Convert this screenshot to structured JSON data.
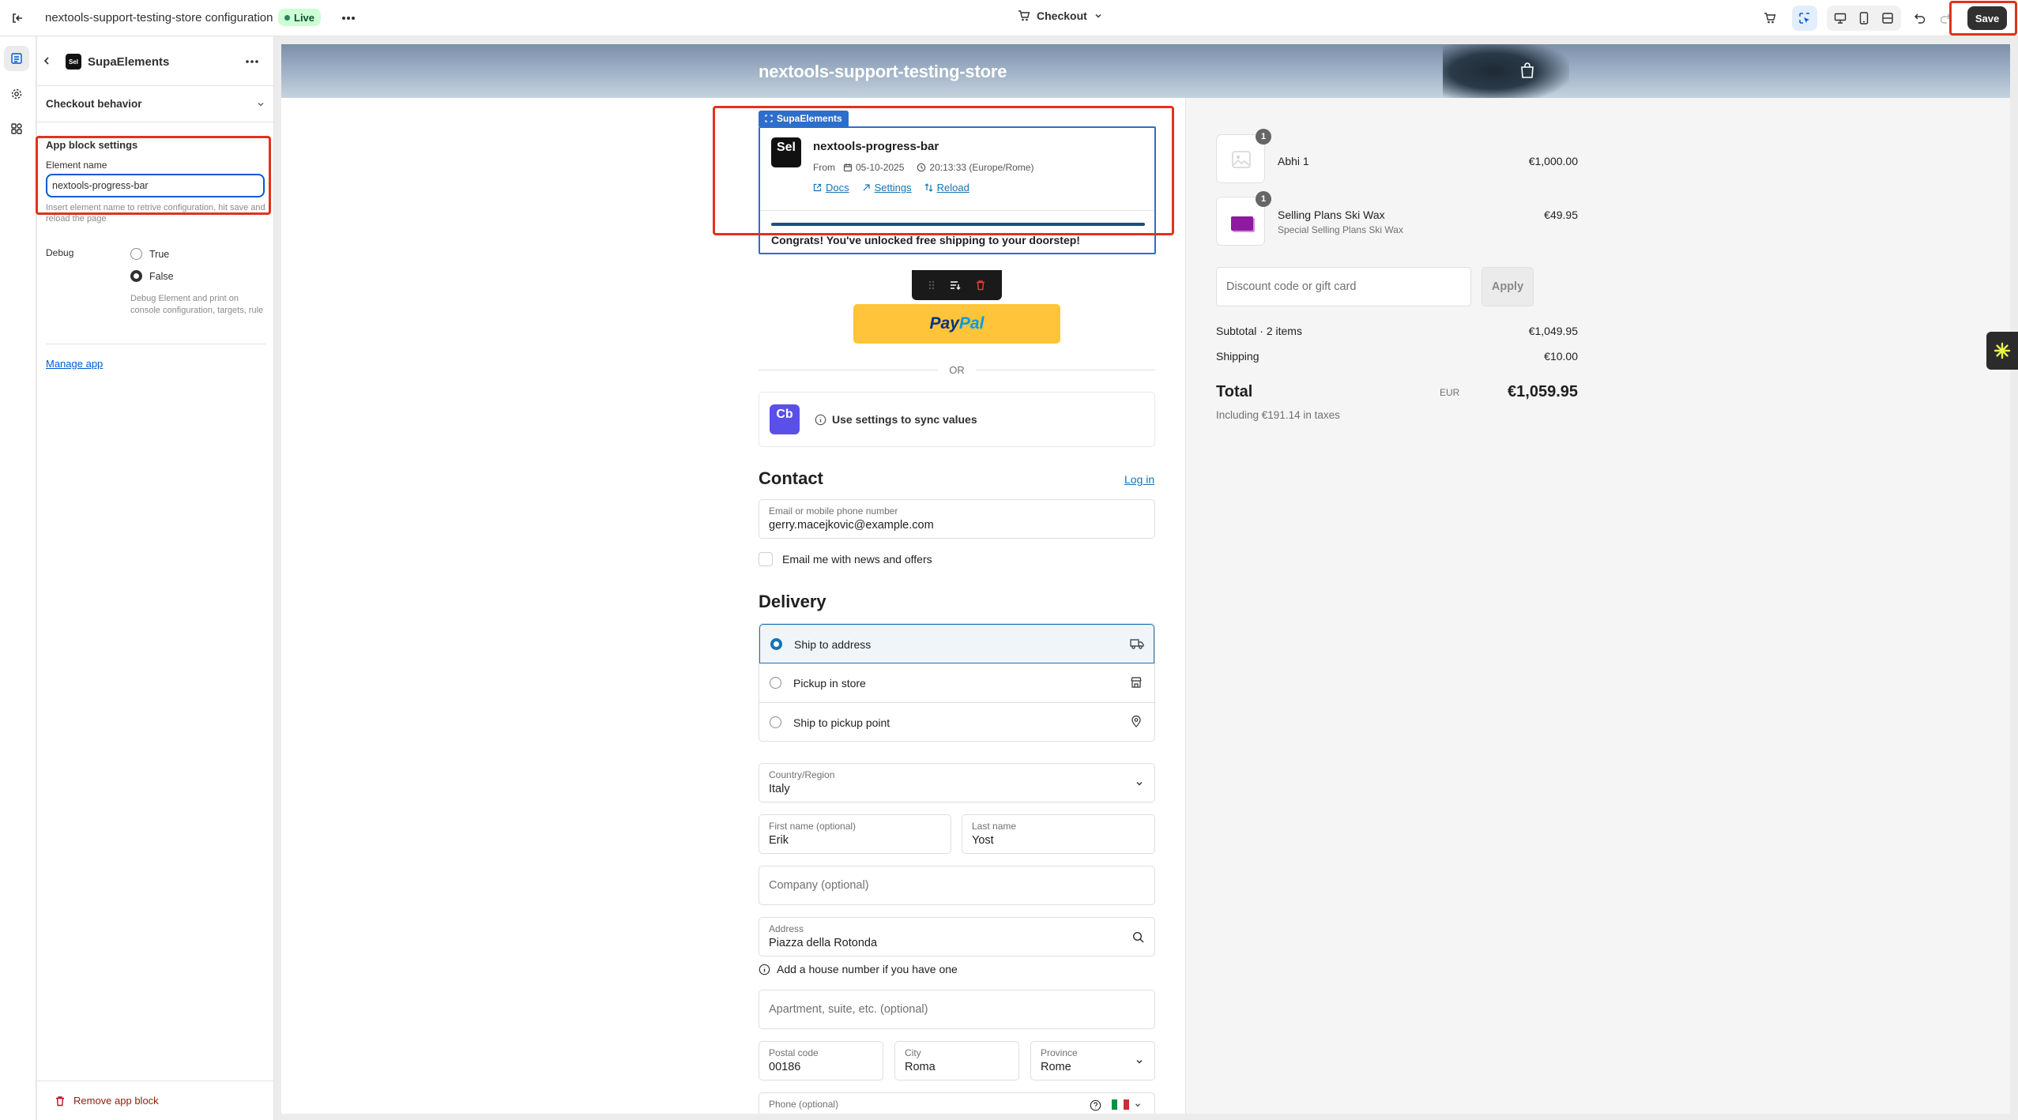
{
  "topbar": {
    "title": "nextools-support-testing-store configuration",
    "live_label": "Live",
    "page_select": "Checkout",
    "save_label": "Save"
  },
  "sidebar": {
    "app_title": "SupaElements",
    "app_logo_text": "Sel",
    "section_title": "Checkout behavior",
    "settings_heading": "App block settings",
    "element_name_label": "Element name",
    "element_name_value": "nextools-progress-bar",
    "element_name_help": "Insert element name to retrive configuration, hit save and reload the page",
    "debug_label": "Debug",
    "debug_options": [
      "True",
      "False"
    ],
    "debug_selected": "False",
    "debug_help": "Debug Element and print on console configuration, targets, rule",
    "manage_app": "Manage app",
    "remove_block": "Remove app block"
  },
  "preview": {
    "store_name": "nextools-support-testing-store",
    "block": {
      "tag": "SupaElements",
      "logo_text": "Sel",
      "element_name": "nextools-progress-bar",
      "from_label": "From",
      "date": "05-10-2025",
      "time": "20:13:33 (Europe/Rome)",
      "docs": "Docs",
      "settings": "Settings",
      "reload": "Reload",
      "progress": 1.0,
      "message": "Congrats! You've unlocked free shipping to your doorstep!"
    },
    "paypal": {
      "pay": "Pay",
      "pal": "Pal"
    },
    "or_label": "OR",
    "sync": {
      "logo": "Cb",
      "text": "Use settings to sync values"
    },
    "contact": {
      "heading": "Contact",
      "login": "Log in",
      "email_label": "Email or mobile phone number",
      "email_value": "gerry.macejkovic@example.com",
      "newsletter": "Email me with news and offers"
    },
    "delivery": {
      "heading": "Delivery",
      "options": [
        "Ship to address",
        "Pickup in store",
        "Ship to pickup point"
      ],
      "selected": "Ship to address",
      "country_label": "Country/Region",
      "country_value": "Italy",
      "first_name_label": "First name (optional)",
      "first_name_value": "Erik",
      "last_name_label": "Last name",
      "last_name_value": "Yost",
      "company_placeholder": "Company (optional)",
      "address_label": "Address",
      "address_value": "Piazza della Rotonda",
      "address_hint": "Add a house number if you have one",
      "apartment_placeholder": "Apartment, suite, etc. (optional)",
      "postal_label": "Postal code",
      "postal_value": "00186",
      "city_label": "City",
      "city_value": "Roma",
      "province_label": "Province",
      "province_value": "Rome",
      "phone_label": "Phone (optional)"
    },
    "summary": {
      "items": [
        {
          "name": "Abhi 1",
          "variant": "",
          "qty": "1",
          "price": "€1,000.00"
        },
        {
          "name": "Selling Plans Ski Wax",
          "variant": "Special Selling Plans Ski Wax",
          "qty": "1",
          "price": "€49.95"
        }
      ],
      "discount_placeholder": "Discount code or gift card",
      "apply": "Apply",
      "subtotal_label": "Subtotal · 2 items",
      "subtotal_value": "€1,049.95",
      "shipping_label": "Shipping",
      "shipping_value": "€10.00",
      "total_label": "Total",
      "currency": "EUR",
      "total_value": "€1,059.95",
      "taxes": "Including €191.14 in taxes"
    }
  },
  "colors": {
    "accent": "#005bd3",
    "highlight": "#e0321d",
    "paypal": "#ffc439",
    "progress": "#1c4f7b"
  }
}
